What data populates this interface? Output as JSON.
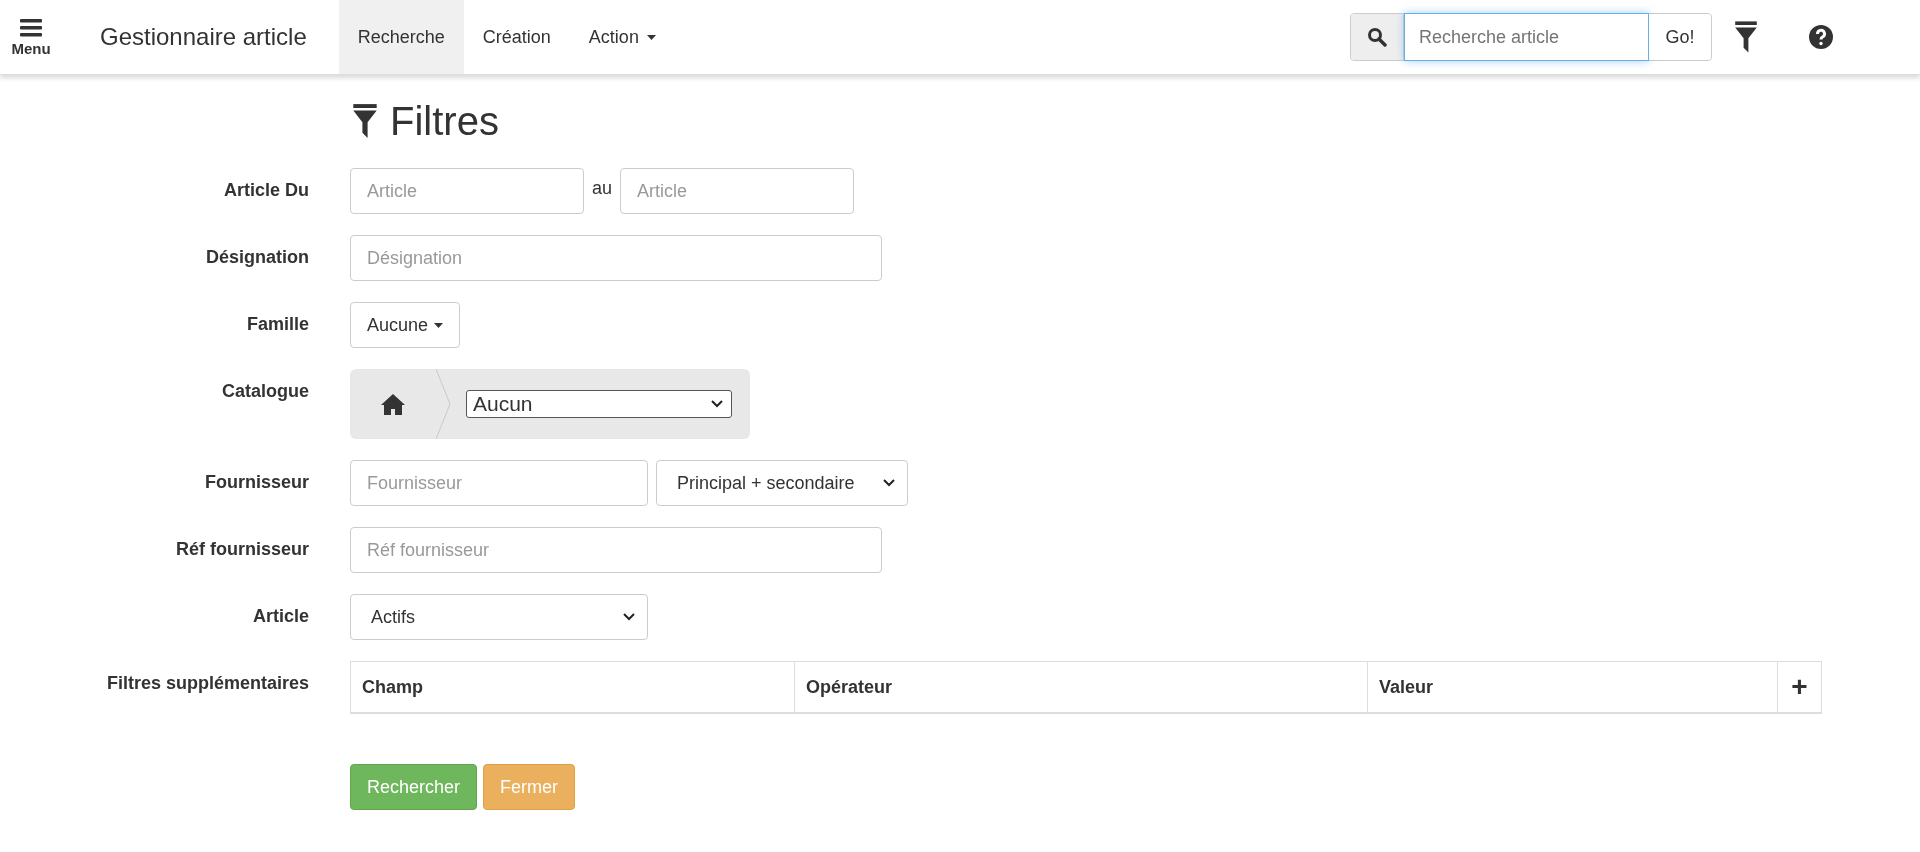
{
  "navbar": {
    "menu_label": "Menu",
    "brand": "Gestionnaire article",
    "tabs": [
      {
        "label": "Recherche",
        "selected": true,
        "dropdown": false
      },
      {
        "label": "Création",
        "selected": false,
        "dropdown": false
      },
      {
        "label": "Action",
        "selected": false,
        "dropdown": true
      }
    ],
    "search": {
      "placeholder": "Recherche article",
      "focused": true,
      "button": "Go!"
    }
  },
  "filters": {
    "title": "Filtres",
    "rows": [
      {
        "kind": "range",
        "label": "Article Du",
        "from_placeholder": "Article",
        "separator": "au",
        "to_placeholder": "Article"
      },
      {
        "kind": "text",
        "label": "Désignation",
        "placeholder": "Désignation"
      },
      {
        "kind": "dropdown",
        "label": "Famille",
        "value": "Aucune"
      },
      {
        "kind": "catalogue",
        "label": "Catalogue",
        "value": "Aucun"
      },
      {
        "kind": "text-select",
        "label": "Fournisseur",
        "placeholder": "Fournisseur",
        "value": "Principal + secondaire"
      },
      {
        "kind": "text",
        "label": "Réf fournisseur",
        "placeholder": "Réf fournisseur"
      },
      {
        "kind": "select",
        "label": "Article",
        "value": "Actifs"
      },
      {
        "kind": "table",
        "label": "Filtres supplémentaires",
        "columns": [
          "Champ",
          "Opérateur",
          "Valeur"
        ],
        "add": "+"
      }
    ],
    "buttons": [
      {
        "label": "Rechercher",
        "kind": "success"
      },
      {
        "label": "Fermer",
        "kind": "warning"
      }
    ]
  }
}
